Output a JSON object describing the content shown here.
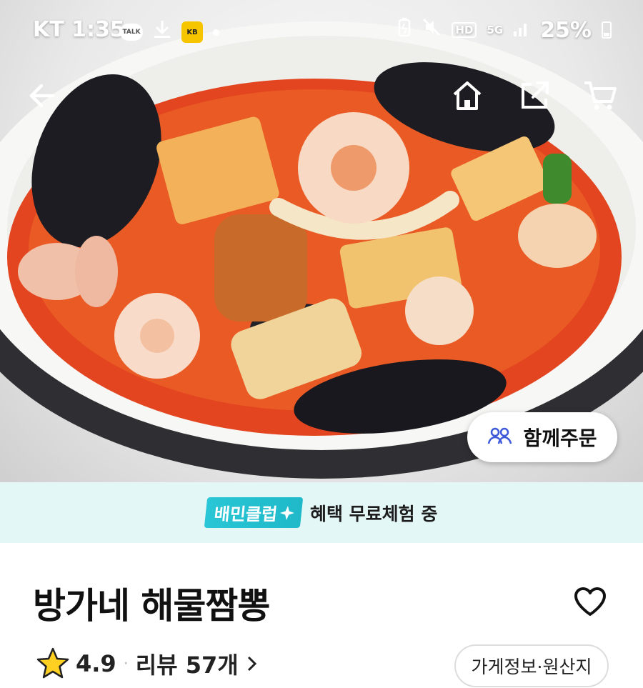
{
  "status_bar": {
    "carrier_time": "KT 1:35",
    "talk_label": "TALK",
    "kb_label": "KB",
    "network": "5G",
    "hd_label": "HD",
    "battery": "25%"
  },
  "nav": {
    "back_icon": "arrow-left-icon",
    "home_icon": "home-icon",
    "share_icon": "share-icon",
    "cart_icon": "cart-icon"
  },
  "together_order": {
    "label": "함께주문",
    "icon": "people-icon"
  },
  "promo": {
    "badge": "배민클럽",
    "text": "혜택 무료체험 중",
    "accent": "#26c1d1",
    "background": "#e4f7f7"
  },
  "store": {
    "name": "방가네 해물짬뽕",
    "rating": "4.9",
    "separator": "·",
    "reviews": "리뷰 57개",
    "info_button": "가게정보·원산지"
  }
}
